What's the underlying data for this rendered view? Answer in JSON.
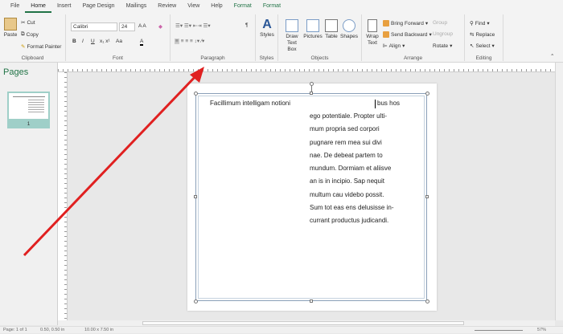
{
  "tabs": [
    "File",
    "Home",
    "Insert",
    "Page Design",
    "Mailings",
    "Review",
    "View",
    "Help",
    "Format",
    "Format"
  ],
  "clipboard": {
    "paste": "Paste",
    "cut": "Cut",
    "copy": "Copy",
    "format_painter": "Format Painter",
    "label": "Clipboard"
  },
  "font": {
    "name": "Calibri",
    "size": "24",
    "label": "Font",
    "bold": "B",
    "italic": "I",
    "underline": "U",
    "case": "Aa"
  },
  "paragraph": {
    "label": "Paragraph",
    "pilcrow": "¶"
  },
  "styles": {
    "button": "Styles",
    "label": "Styles"
  },
  "objects": {
    "draw_text_box": "Draw Text Box",
    "pictures": "Pictures",
    "table": "Table",
    "shapes": "Shapes",
    "label": "Objects"
  },
  "arrange": {
    "wrap_text": "Wrap Text",
    "bring_forward": "Bring Forward",
    "send_backward": "Send Backward",
    "align": "Align",
    "group": "Group",
    "ungroup": "Ungroup",
    "rotate": "Rotate",
    "label": "Arrange"
  },
  "editing": {
    "find": "Find",
    "replace": "Replace",
    "select": "Select",
    "label": "Editing"
  },
  "pages_pane": {
    "title": "Pages",
    "page_number": "1"
  },
  "document": {
    "first_line_left": "Facillimum intelligam notioni",
    "first_line_right": "bus hos",
    "lines": [
      "ego potentiale. Propter ulti-",
      "mum propria sed corpori",
      "pugnare rem mea sui divi",
      "nae. De debeat partem to",
      "mundum. Dormiam et aliisve",
      "an is in incipio. Sap nequit",
      "multum cau videbo possit.",
      "Sum tot eas ens delusisse in-",
      "currant productus judicandi."
    ]
  },
  "status": {
    "page": "Page: 1 of 1",
    "position": "0.50, 0.50 in",
    "size": "10.00 x 7.50 in",
    "zoom": "57%"
  },
  "colors": {
    "accent": "#217346",
    "arrow": "#e02020"
  }
}
